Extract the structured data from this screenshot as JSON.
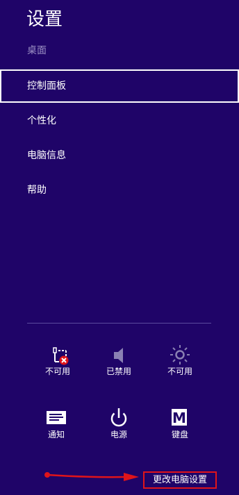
{
  "header": {
    "title": "设置",
    "subtitle": "桌面"
  },
  "menu": {
    "items": [
      {
        "label": "控制面板",
        "selected": true
      },
      {
        "label": "个性化",
        "selected": false
      },
      {
        "label": "电脑信息",
        "selected": false
      },
      {
        "label": "帮助",
        "selected": false
      }
    ]
  },
  "quick_settings": {
    "row1": [
      {
        "icon": "network-unavailable-icon",
        "label": "不可用"
      },
      {
        "icon": "volume-muted-icon",
        "label": "已禁用"
      },
      {
        "icon": "brightness-icon",
        "label": "不可用"
      }
    ],
    "row2": [
      {
        "icon": "notification-icon",
        "label": "通知"
      },
      {
        "icon": "power-icon",
        "label": "电源"
      },
      {
        "icon": "keyboard-icon",
        "label": "键盘"
      }
    ]
  },
  "footer": {
    "change_pc_settings": "更改电脑设置"
  },
  "colors": {
    "background": "#1f0468",
    "annotation_red": "#e0141a",
    "muted_text": "#9b8fc4"
  }
}
